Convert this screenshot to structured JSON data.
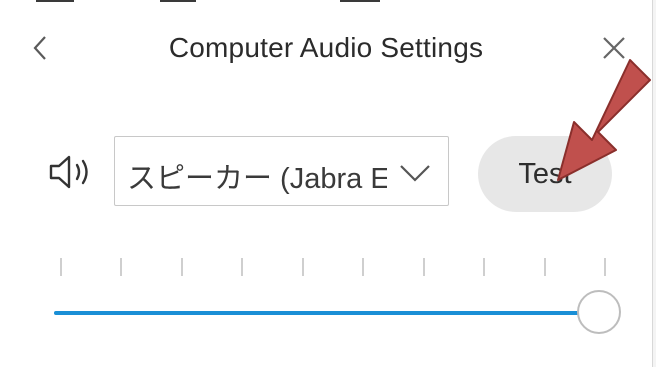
{
  "window": {
    "title": "Computer Audio Settings",
    "back_icon": "chevron-left-icon",
    "close_icon": "close-icon"
  },
  "speaker": {
    "icon": "speaker-icon",
    "device_select": {
      "value": "スピーカー (Jabra E",
      "chevron_icon": "chevron-down-icon"
    },
    "test_label": "Test"
  },
  "annotation": {
    "arrow_color": "#c0504d",
    "arrow_outline": "#8a2f2c"
  },
  "volume": {
    "level": 0.98,
    "tick_count": 10,
    "fill_color": "#1a8fd6"
  }
}
